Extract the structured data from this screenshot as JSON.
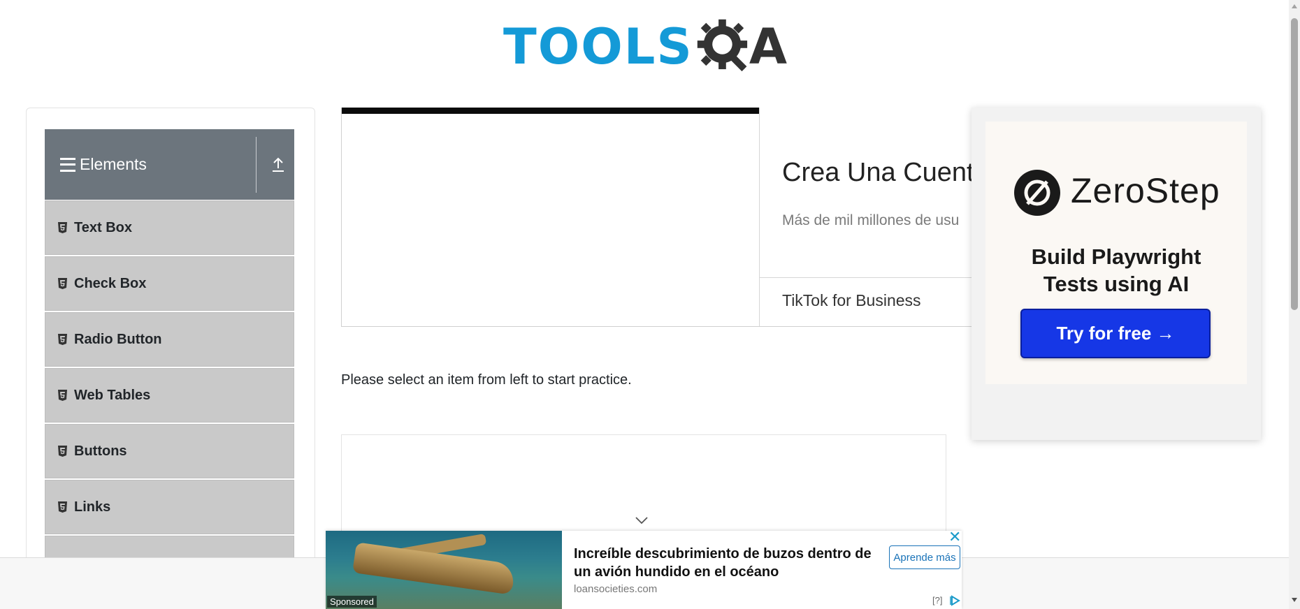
{
  "header": {
    "logo_left": "TOOLS",
    "logo_right": "A"
  },
  "sidebar": {
    "group_title": "Elements",
    "items": [
      {
        "label": "Text Box"
      },
      {
        "label": "Check Box"
      },
      {
        "label": "Radio Button"
      },
      {
        "label": "Web Tables"
      },
      {
        "label": "Buttons"
      },
      {
        "label": "Links"
      }
    ]
  },
  "ad_top": {
    "title": "Crea Una Cuenta",
    "subtitle": "Más de mil millones de usu",
    "brand": "TikTok for Business"
  },
  "main": {
    "practice_text": "Please select an item from left to start practice."
  },
  "ad_right": {
    "brand": "ZeroStep",
    "headline_line1": "Build Playwright",
    "headline_line2": "Tests using AI",
    "cta": "Try for free →"
  },
  "bottom_ad": {
    "sponsored_label": "Sponsored",
    "title": "Increíble descubrimiento de buzos dentro de un avión hundido en el océano",
    "domain": "loansocieties.com",
    "cta": "Aprende más",
    "info": "[?]",
    "close_glyph": "✕"
  },
  "colors": {
    "logo_blue": "#149ad7",
    "logo_dark": "#333333",
    "sidebar_header": "#6c757d",
    "sidebar_item": "#c9c9c9",
    "zerostep_cta": "#1637e6"
  }
}
